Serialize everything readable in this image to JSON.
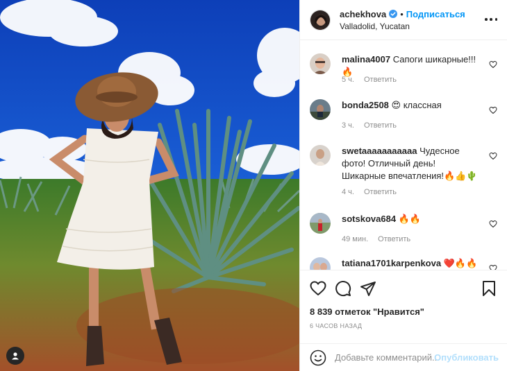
{
  "post": {
    "author": "achekhova",
    "verified": true,
    "separator": "•",
    "follow_label": "Подписаться",
    "location": "Valladolid, Yucatan",
    "likes_text": "8 839 отметок \"Нравится\"",
    "time_ago": "6 ЧАСОВ НАЗАД"
  },
  "comments": [
    {
      "user": "malina4007",
      "text": "Сапоги шикарные!!!🔥",
      "time": "5 ч.",
      "reply_label": "Ответить"
    },
    {
      "user": "bonda2508",
      "text": "😍 классная",
      "time": "3 ч.",
      "reply_label": "Ответить"
    },
    {
      "user": "swetaaaaaaaaaaa",
      "text": "Чудесное фото! Отличный день! Шикарные впечатления!🔥👍🌵",
      "time": "4 ч.",
      "reply_label": "Ответить"
    },
    {
      "user": "sotskova684",
      "text": "🔥🔥",
      "time": "49 мин.",
      "reply_label": "Ответить"
    },
    {
      "user": "tatiana1701karpenkova",
      "text": "❤️🔥🔥🔥",
      "time": "",
      "reply_label": ""
    }
  ],
  "add_comment": {
    "placeholder": "Добавьте комментарий...",
    "publish_label": "Опубликовать"
  },
  "icons": {
    "like": "heart-icon",
    "comment": "comment-icon",
    "share": "paper-plane-icon",
    "save": "bookmark-icon",
    "emoji": "smiley-icon",
    "more": "more-dots-icon",
    "tag": "user-tag-icon"
  },
  "colors": {
    "accent": "#0095f6",
    "publish_disabled": "#b2dffc",
    "muted": "#8e8e8e",
    "text": "#262626"
  }
}
